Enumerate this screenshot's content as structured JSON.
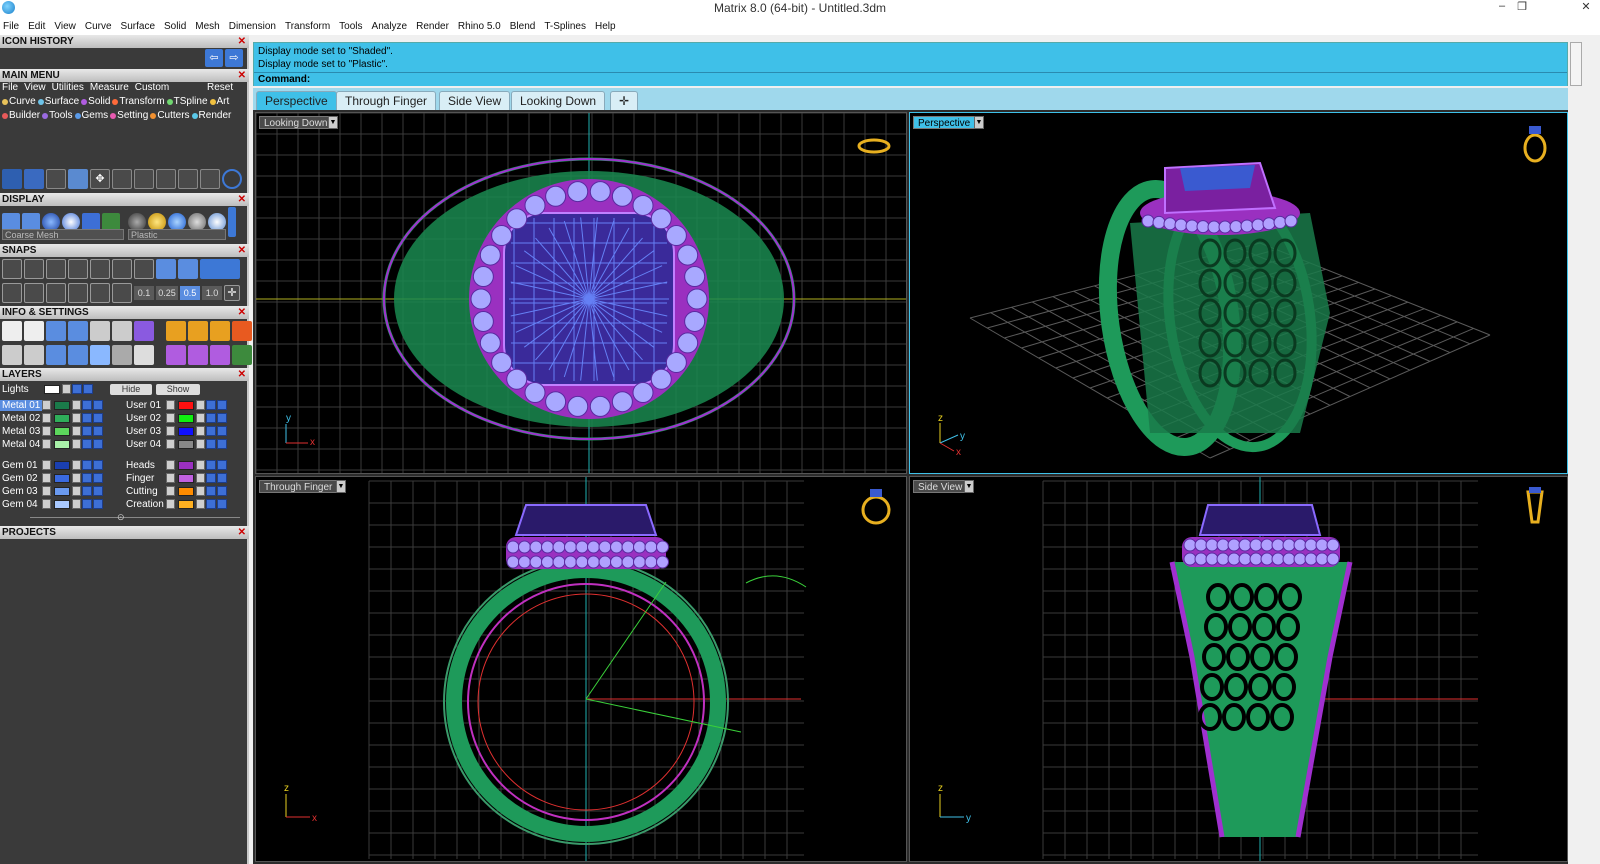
{
  "window": {
    "title": "Matrix 8.0 (64-bit) - Untitled.3dm",
    "minimize": "–",
    "restore": "❐",
    "close": "✕"
  },
  "menubar": [
    "File",
    "Edit",
    "View",
    "Curve",
    "Surface",
    "Solid",
    "Mesh",
    "Dimension",
    "Transform",
    "Tools",
    "Analyze",
    "Render",
    "Rhino 5.0",
    "Blend",
    "T-Splines",
    "Help"
  ],
  "left": {
    "icon_history": {
      "title": "ICON HISTORY"
    },
    "main_menu": {
      "title": "MAIN MENU",
      "top_items": [
        "File",
        "View",
        "Utilities",
        "Measure",
        "Custom"
      ],
      "reset": "Reset",
      "row1": [
        {
          "label": "Curve",
          "color": "#e8c25a"
        },
        {
          "label": "Surface",
          "color": "#6ec3e8"
        },
        {
          "label": "Solid",
          "color": "#b05ce0"
        },
        {
          "label": "Transform",
          "color": "#ff6a3a"
        },
        {
          "label": "TSpline",
          "color": "#6fd66f"
        },
        {
          "label": "Art",
          "color": "#f0c040"
        }
      ],
      "row2": [
        {
          "label": "Builder",
          "color": "#e85a5a"
        },
        {
          "label": "Tools",
          "color": "#9a6ae0"
        },
        {
          "label": "Gems",
          "color": "#5a9ae8"
        },
        {
          "label": "Setting",
          "color": "#e85ab0"
        },
        {
          "label": "Cutters",
          "color": "#f09030"
        },
        {
          "label": "Render",
          "color": "#5ac8e8"
        }
      ]
    },
    "display": {
      "title": "DISPLAY",
      "mesh_select": "Coarse Mesh",
      "material_select": "Plastic"
    },
    "snaps": {
      "title": "SNAPS",
      "values": [
        "0.1",
        "0.25",
        "0.5",
        "1.0"
      ]
    },
    "info": {
      "title": "INFO & SETTINGS"
    },
    "layers": {
      "title": "LAYERS",
      "lights": "Lights",
      "hide": "Hide",
      "show": "Show",
      "left_col": [
        {
          "name": "Metal 01",
          "color": "#1a7a4a",
          "selected": true
        },
        {
          "name": "Metal 02",
          "color": "#2fae5a"
        },
        {
          "name": "Metal 03",
          "color": "#5cd65c"
        },
        {
          "name": "Metal 04",
          "color": "#a8f0a8"
        },
        {
          "name": "Gem 01",
          "color": "#1a3fb0"
        },
        {
          "name": "Gem 02",
          "color": "#3a6ae0"
        },
        {
          "name": "Gem 03",
          "color": "#6a9af0"
        },
        {
          "name": "Gem 04",
          "color": "#a8c8ff"
        }
      ],
      "right_col": [
        {
          "name": "User 01",
          "color": "#ff1010"
        },
        {
          "name": "User 02",
          "color": "#10f010"
        },
        {
          "name": "User 03",
          "color": "#1010ff"
        },
        {
          "name": "User 04",
          "color": "#888888"
        },
        {
          "name": "Heads",
          "color": "#9a30c0"
        },
        {
          "name": "Finger",
          "color": "#c060e0"
        },
        {
          "name": "Cutting",
          "color": "#ff8c00"
        },
        {
          "name": "Creation",
          "color": "#ffb020"
        }
      ]
    },
    "projects": {
      "title": "PROJECTS"
    }
  },
  "command": {
    "history": [
      "Display mode set to \"Shaded\".",
      "Display mode set to \"Plastic\"."
    ],
    "prompt": "Command:"
  },
  "tabs": [
    "Perspective",
    "Through Finger",
    "Side View",
    "Looking Down"
  ],
  "tab_add": "✛",
  "viewports": {
    "looking_down": "Looking Down",
    "perspective": "Perspective",
    "through_finger": "Through Finger",
    "side_view": "Side View"
  },
  "axes": {
    "x": "x",
    "y": "y",
    "z": "z"
  },
  "colors": {
    "accent": "#3fc0e8",
    "metal": "#1e9a5a",
    "gems": "#9a9aff",
    "heads": "#a030d0"
  }
}
